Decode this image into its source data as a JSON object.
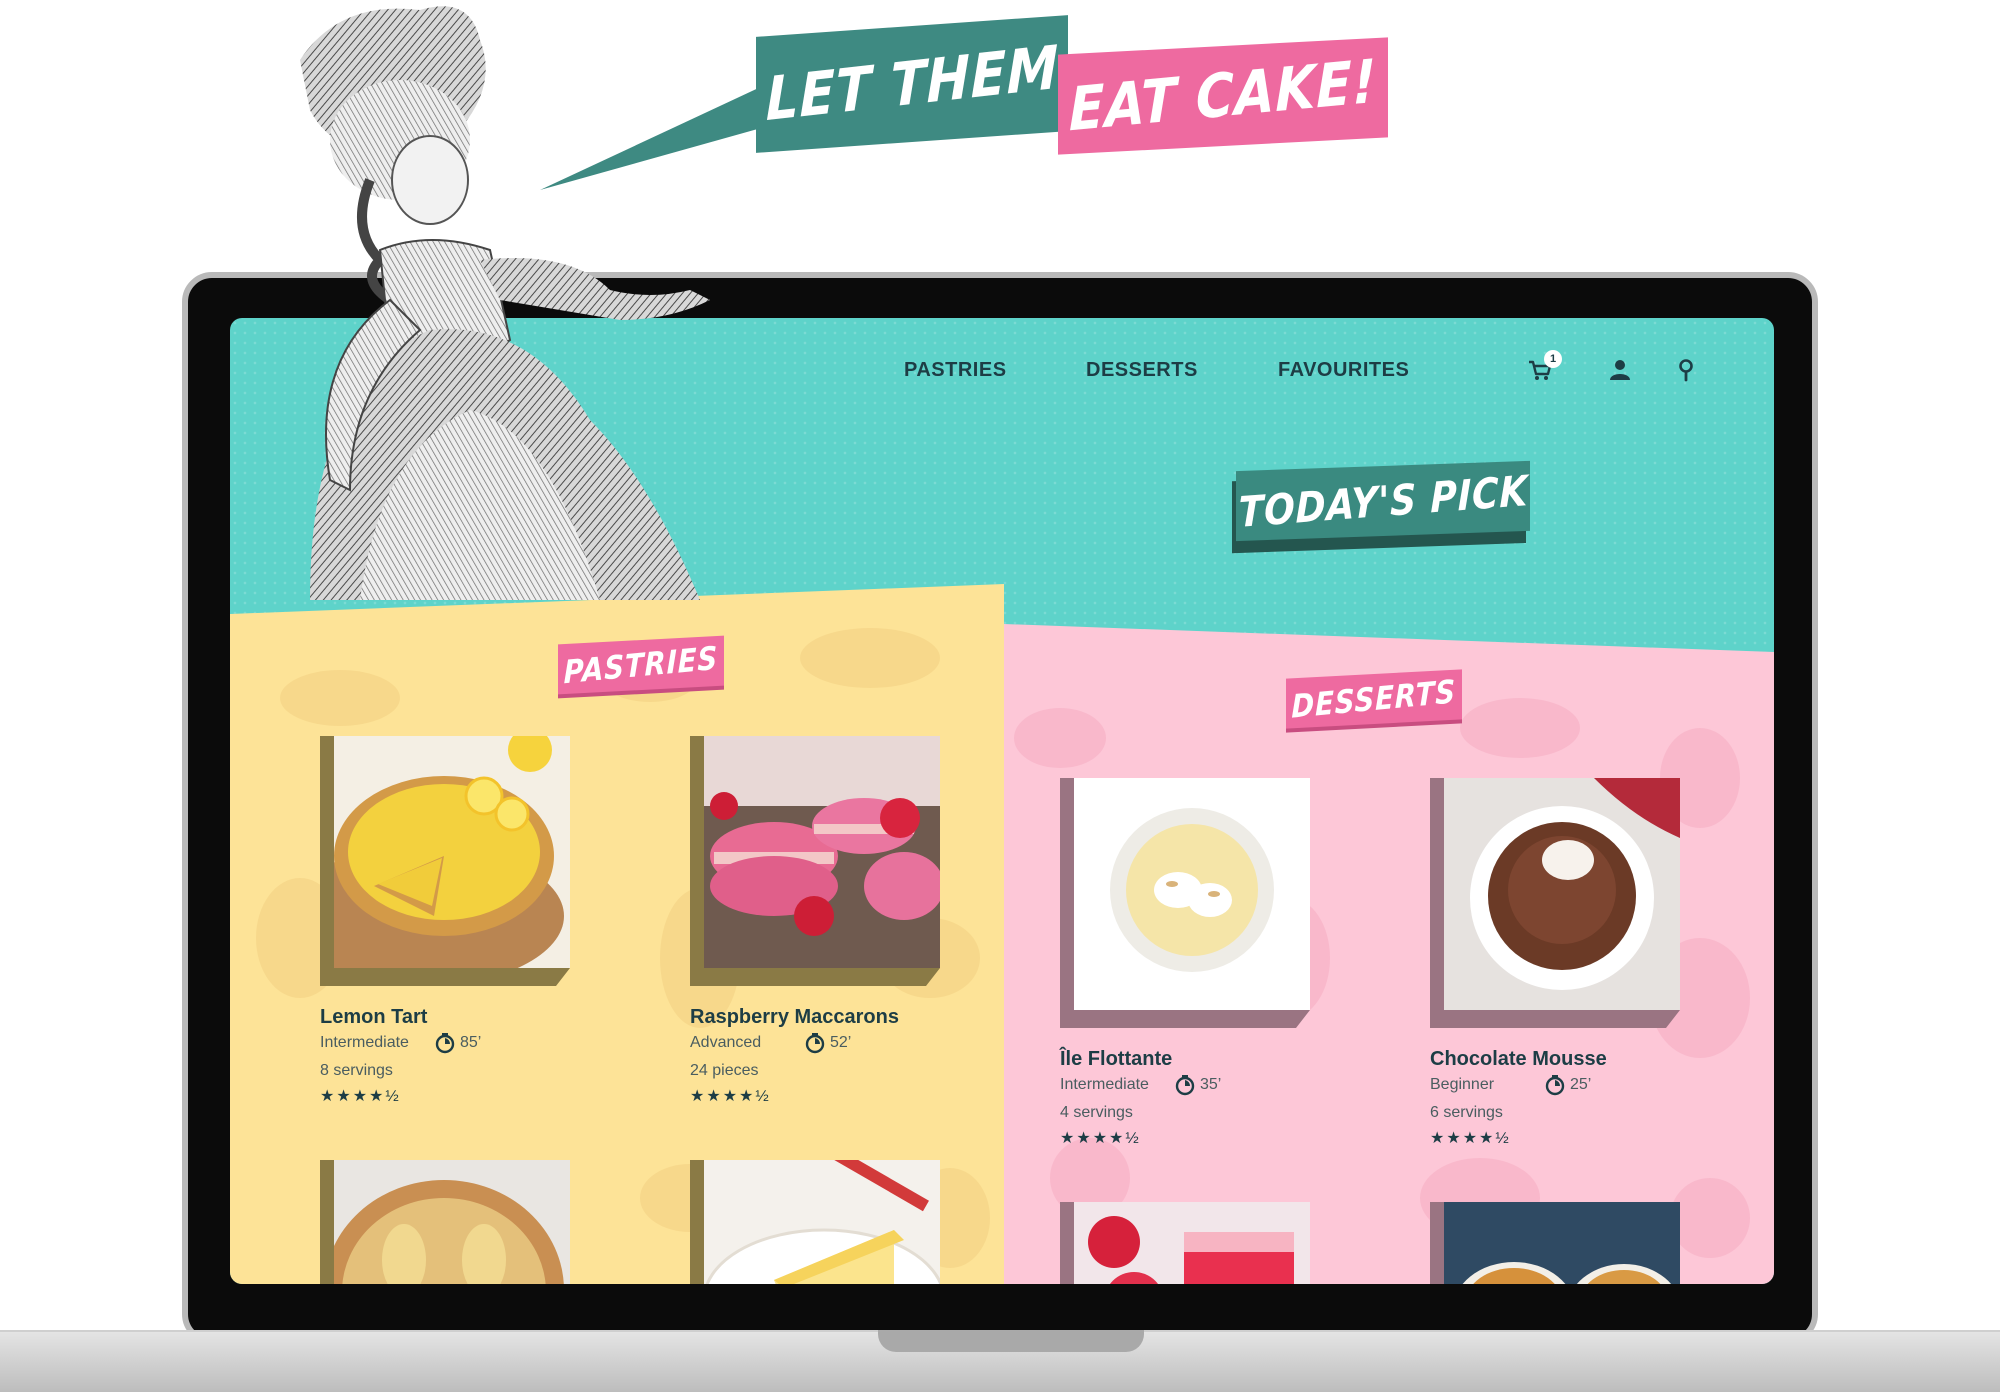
{
  "headline": {
    "part1": "LET THEM",
    "part2": "EAT CAKE!"
  },
  "nav": {
    "links": [
      "PASTRIES",
      "DESSERTS",
      "FAVOURITES"
    ],
    "cart_count": "1",
    "icons": [
      "cart-icon",
      "user-icon",
      "search-icon"
    ]
  },
  "todays_pick": "TODAY'S PICK",
  "sections": {
    "pastries": {
      "label": "PASTRIES",
      "cards": [
        {
          "title": "Lemon Tart",
          "level": "Intermediate",
          "time": "85’",
          "servings": "8 servings",
          "stars": "★★★★½"
        },
        {
          "title": "Raspberry Maccarons",
          "level": "Advanced",
          "time": "52’",
          "servings": "24 pieces",
          "stars": "★★★★½"
        }
      ]
    },
    "desserts": {
      "label": "DESSERTS",
      "cards": [
        {
          "title": "Île Flottante",
          "level": "Intermediate",
          "time": "35’",
          "servings": "4 servings",
          "stars": "★★★★½"
        },
        {
          "title": "Chocolate Mousse",
          "level": "Beginner",
          "time": "25’",
          "servings": "6 servings",
          "stars": "★★★★½"
        }
      ]
    }
  },
  "colors": {
    "teal_bg": "#5ed3ca",
    "teal_tag": "#3e8a82",
    "pink_tag": "#ee6aa0",
    "yellow_panel": "#fde397",
    "pink_panel": "#fdc7d7",
    "text_dark": "#1d3d45"
  }
}
